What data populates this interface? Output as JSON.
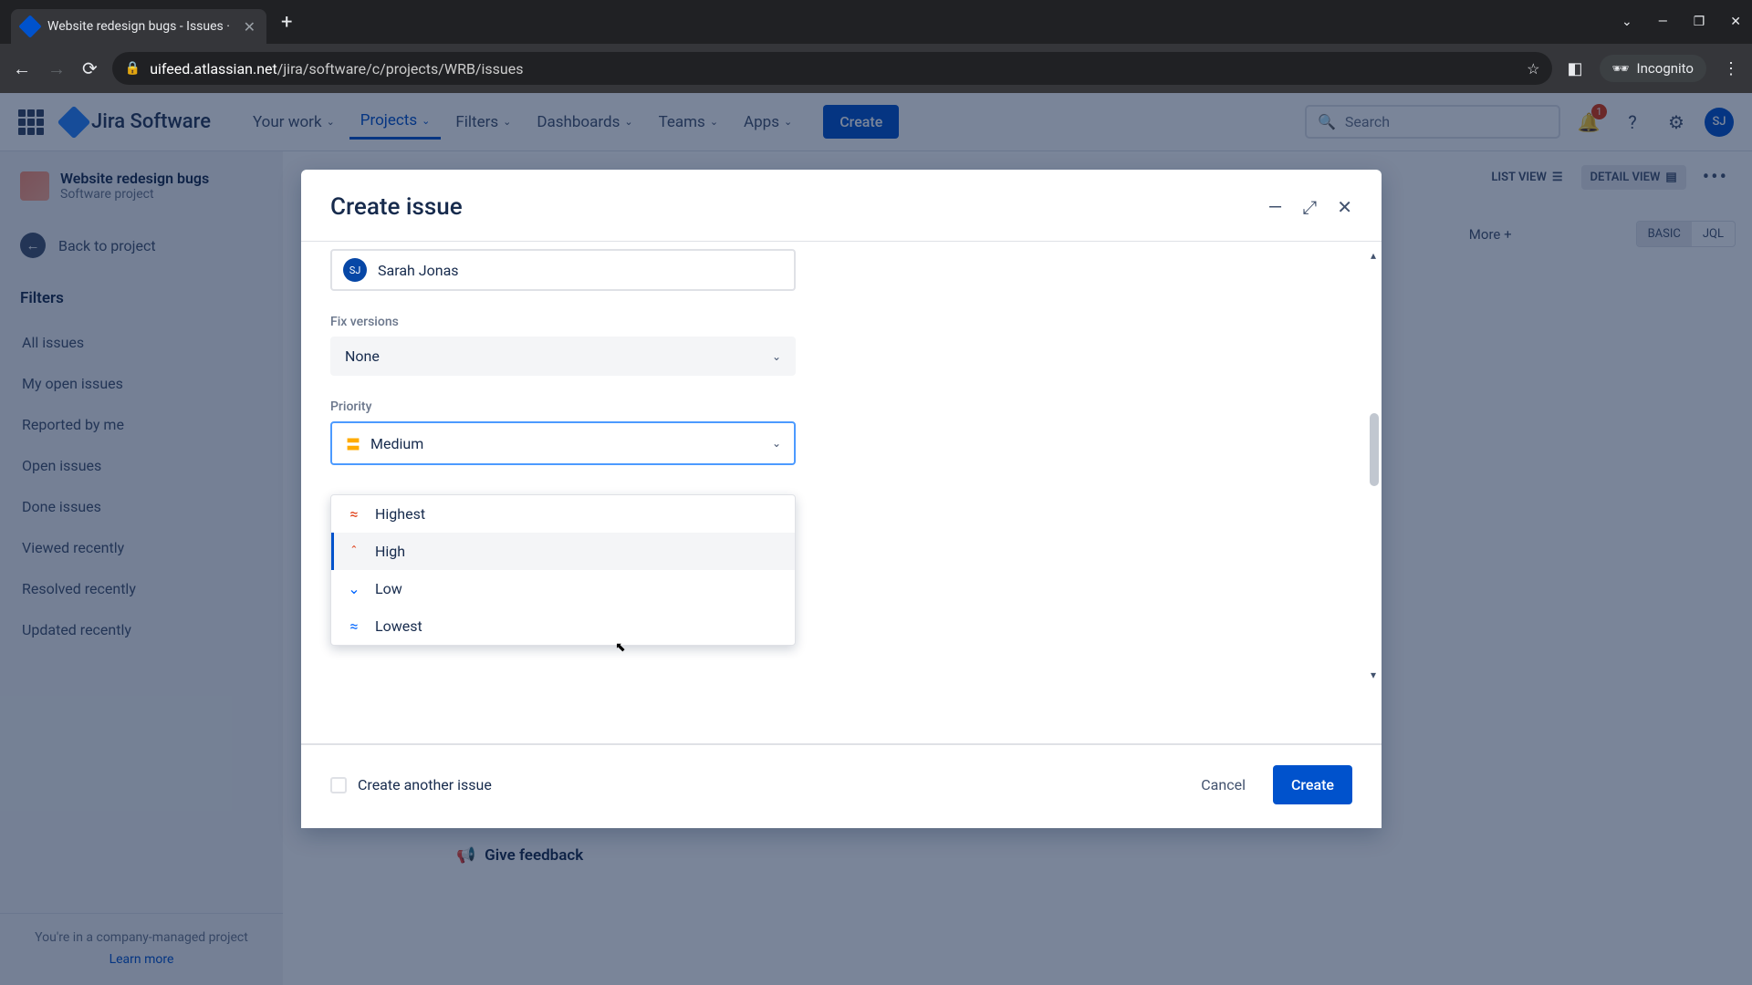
{
  "browser": {
    "tab_title": "Website redesign bugs - Issues ·",
    "url_prefix": "uifeed.atlassian.net",
    "url_path": "/jira/software/c/projects/WRB/issues",
    "incognito_label": "Incognito"
  },
  "header": {
    "product": "Jira Software",
    "nav": {
      "your_work": "Your work",
      "projects": "Projects",
      "filters": "Filters",
      "dashboards": "Dashboards",
      "teams": "Teams",
      "apps": "Apps"
    },
    "create": "Create",
    "search_placeholder": "Search",
    "notification_count": "1",
    "avatar_initials": "SJ"
  },
  "sidebar": {
    "project_name": "Website redesign bugs",
    "project_type": "Software project",
    "back": "Back to project",
    "filters_heading": "Filters",
    "items": [
      "All issues",
      "My open issues",
      "Reported by me",
      "Open issues",
      "Done issues",
      "Viewed recently",
      "Resolved recently",
      "Updated recently"
    ],
    "footer_text": "You're in a company-managed project",
    "learn_more": "Learn more"
  },
  "background": {
    "list_view": "LIST VIEW",
    "detail_view": "DETAIL VIEW",
    "more": "More +",
    "basic": "BASIC",
    "jql": "JQL",
    "feedback": "Give feedback"
  },
  "modal": {
    "title": "Create issue",
    "assignee": {
      "initials": "SJ",
      "name": "Sarah Jonas"
    },
    "fields": {
      "fix_versions_label": "Fix versions",
      "fix_versions_value": "None",
      "priority_label": "Priority",
      "priority_value": "Medium"
    },
    "priority_options": [
      {
        "label": "Highest",
        "icon": "highest"
      },
      {
        "label": "High",
        "icon": "high"
      },
      {
        "label": "Low",
        "icon": "low"
      },
      {
        "label": "Lowest",
        "icon": "lowest"
      }
    ],
    "hovered_option_index": 1,
    "footer": {
      "create_another": "Create another issue",
      "cancel": "Cancel",
      "submit": "Create"
    }
  }
}
